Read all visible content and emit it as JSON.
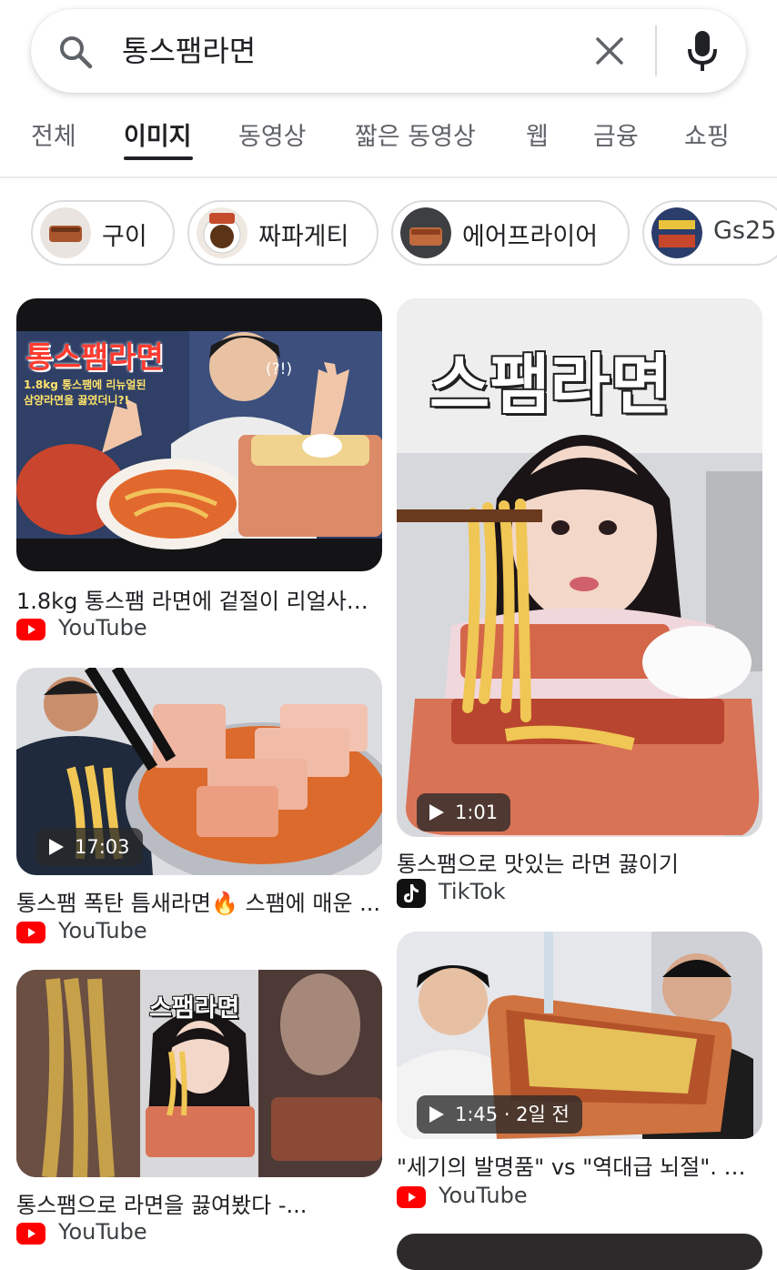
{
  "search": {
    "query": "통스팸라면"
  },
  "tabs": [
    "전체",
    "이미지",
    "동영상",
    "짧은 동영상",
    "웹",
    "금융",
    "쇼핑"
  ],
  "active_tab": "이미지",
  "chips": [
    "구이",
    "짜파게티",
    "에어프라이어",
    "Gs25"
  ],
  "results": [
    {
      "overlay_title": "통스팸라면",
      "overlay_sub1": "1.8kg 통스팸에 리뉴얼된",
      "overlay_sub2": "삼양라면을 끓였더니?!",
      "overlay_tag": "(?!)",
      "caption": "1.8kg 통스팸 라면에 겉절이 리얼사운...",
      "source": "YouTube"
    },
    {
      "overlay_title": "스팸라면",
      "badge": "1:01",
      "caption": "통스팸으로 맛있는 라면 끓이기",
      "source": "TikTok"
    },
    {
      "badge": "17:03",
      "caption": "통스팸 폭탄 틈새라면🔥 스팸에 매운 ...",
      "source": "YouTube"
    },
    {
      "badge": "1:45 · 2일 전",
      "caption": "\"세기의 발명품\" vs \"역대급 뇌절\". 통...",
      "source": "YouTube"
    },
    {
      "overlay_title": "스팸라면",
      "caption": "통스팸으로 라면을 끓여봤다 -...",
      "source": "YouTube"
    }
  ],
  "colors": {
    "youtube_red": "#ff0000",
    "accent": "#202124",
    "chip_border": "#dadce0"
  }
}
